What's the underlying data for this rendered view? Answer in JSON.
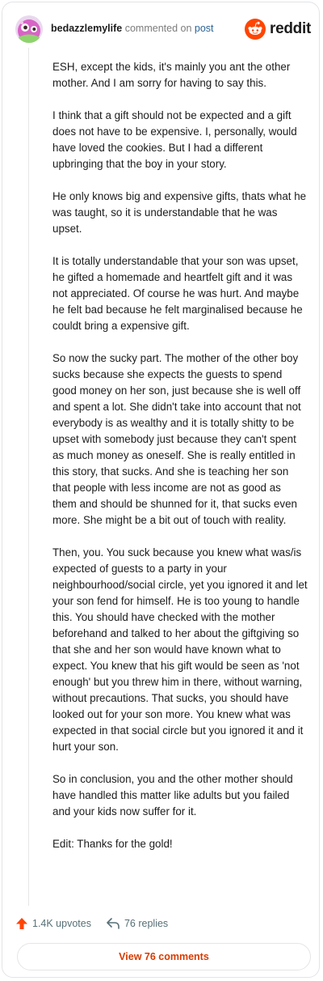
{
  "header": {
    "username": "bedazzlemylife",
    "action": "commented on",
    "post_link": "post",
    "brand": "reddit",
    "avatar_icon": "avatar-image",
    "brand_icon": "reddit-alien-icon"
  },
  "comment": {
    "paragraphs": [
      "ESH, except the kids, it's mainly you ant the other mother. And I am sorry for having to say this.",
      "I think that a gift should not be expected and a gift does not have to be expensive. I, personally, would have loved the cookies. But I had a different upbringing that the boy in your story.",
      "He only knows big and expensive gifts, thats what he was taught, so it is understandable that he was upset.",
      "It is totally understandable that your son was upset, he gifted a homemade and heartfelt gift and it was not appreciated. Of course he was hurt. And maybe he felt bad because he felt marginalised because he couldt bring a expensive gift.",
      "So now the sucky part. The mother of the other boy sucks because she expects the guests to spend good money on her son, just because she is well off and spent a lot. She didn't take into account that not everybody is as wealthy and it is totally shitty to be upset with somebody just because they can't spent as much money as oneself. She is really entitled in this story, that sucks. And she is teaching her son that people with less income are not as good as them and should be shunned for it, that sucks even more. She might be a bit out of touch with reality.",
      "Then, you. You suck because you knew what was/is expected of guests to a party in your neighbourhood/social circle, yet you ignored it and let your son fend for himself. He is too young to handle this. You should have checked with the mother beforehand and talked to her about the giftgiving so that she and her son would have known what to expect. You knew that his gift would be seen as 'not enough' but you threw him in there, without warning, without precautions. That sucks, you should have looked out for your son more. You knew what was expected in that social circle but you ignored it and it hurt your son.",
      "So in conclusion, you and the other mother should have handled this matter like adults but you failed and your kids now suffer for it.",
      "Edit: Thanks for the gold!"
    ]
  },
  "footer": {
    "upvotes": "1.4K upvotes",
    "replies": "76 replies",
    "upvote_icon": "upvote-arrow-icon",
    "reply_icon": "reply-arrow-icon"
  },
  "view_button": {
    "label": "View 76 comments"
  },
  "colors": {
    "accent": "#d93a00",
    "upvote": "#ff4500",
    "brand": "#ff4500",
    "link": "#2a6496"
  }
}
